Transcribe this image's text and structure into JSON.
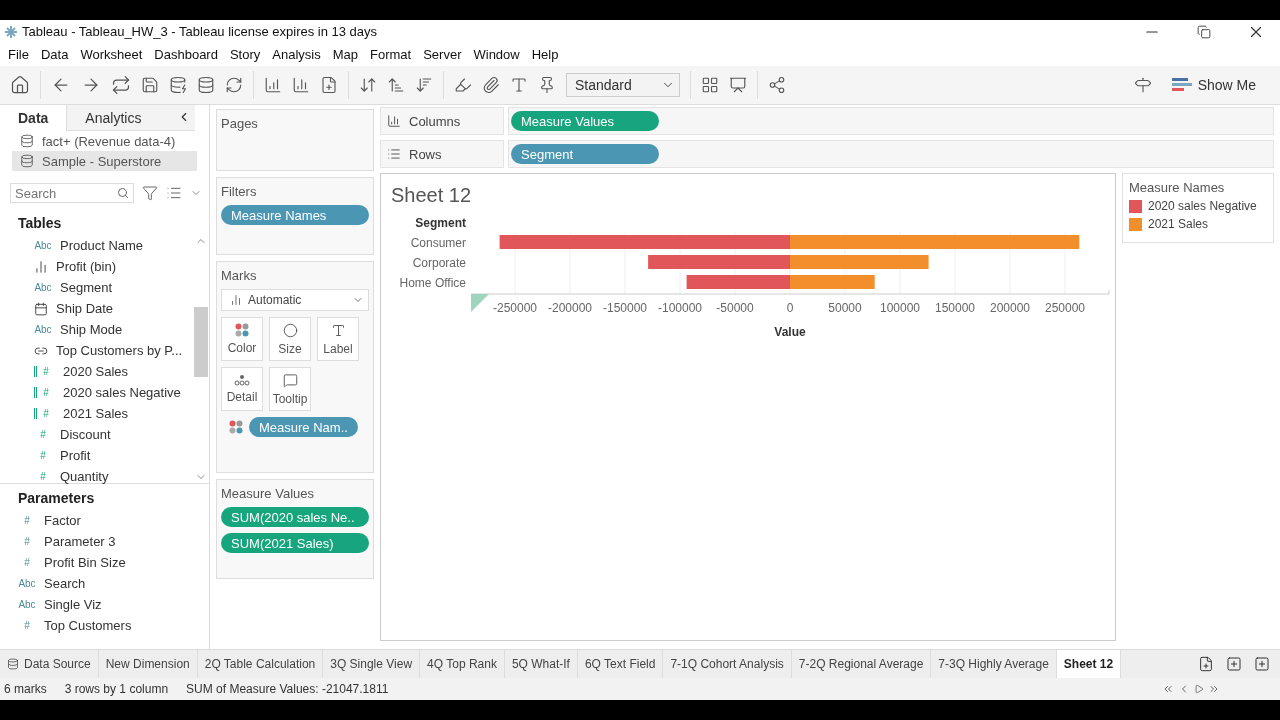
{
  "window": {
    "title": "Tableau - Tableau_HW_3 - Tableau license expires in 13 days"
  },
  "menu": [
    "File",
    "Data",
    "Worksheet",
    "Dashboard",
    "Story",
    "Analysis",
    "Map",
    "Format",
    "Server",
    "Window",
    "Help"
  ],
  "toolbar": {
    "fit": "Standard",
    "show_me": "Show Me"
  },
  "side_tabs": [
    {
      "label": "Data",
      "selected": true
    },
    {
      "label": "Analytics",
      "selected": false
    }
  ],
  "data_sources": [
    {
      "label": "fact+ (Revenue data-4)",
      "selected": false
    },
    {
      "label": "Sample - Superstore",
      "selected": true
    }
  ],
  "search": {
    "placeholder": "Search"
  },
  "tables": {
    "title": "Tables",
    "fields": [
      {
        "label": "Product Name",
        "kind": "text",
        "badge": "Abc"
      },
      {
        "label": "Profit (bin)",
        "kind": "bin"
      },
      {
        "label": "Segment",
        "kind": "text",
        "badge": "Abc"
      },
      {
        "label": "Ship Date",
        "kind": "date"
      },
      {
        "label": "Ship Mode",
        "kind": "text",
        "badge": "Abc"
      },
      {
        "label": "Top Customers by P...",
        "kind": "set"
      },
      {
        "label": "2020 Sales",
        "kind": "calc",
        "badge": "#"
      },
      {
        "label": "2020 sales Negative",
        "kind": "calc",
        "badge": "#"
      },
      {
        "label": "2021 Sales",
        "kind": "calc",
        "badge": "#"
      },
      {
        "label": "Discount",
        "kind": "number",
        "badge": "#"
      },
      {
        "label": "Profit",
        "kind": "number",
        "badge": "#"
      },
      {
        "label": "Quantity",
        "kind": "number",
        "badge": "#"
      }
    ]
  },
  "parameters": {
    "title": "Parameters",
    "fields": [
      {
        "label": "Factor",
        "badge": "#"
      },
      {
        "label": "Parameter 3",
        "badge": "#"
      },
      {
        "label": "Profit Bin Size",
        "badge": "#"
      },
      {
        "label": "Search",
        "badge": "Abc"
      },
      {
        "label": "Single Viz",
        "badge": "Abc"
      },
      {
        "label": "Top Customers",
        "badge": "#"
      }
    ]
  },
  "pages": {
    "title": "Pages"
  },
  "filters": {
    "title": "Filters",
    "pills": [
      {
        "label": "Measure Names",
        "kind": "dimension"
      }
    ]
  },
  "marks": {
    "title": "Marks",
    "type": "Automatic",
    "cards": [
      {
        "label": "Color",
        "kind": "color"
      },
      {
        "label": "Size",
        "kind": "size"
      },
      {
        "label": "Label",
        "kind": "label"
      },
      {
        "label": "Detail",
        "kind": "detail"
      },
      {
        "label": "Tooltip",
        "kind": "tooltip"
      }
    ],
    "pills": [
      {
        "label": "Measure Nam..",
        "kind": "dimension"
      }
    ]
  },
  "measure_values": {
    "title": "Measure Values",
    "pills": [
      {
        "label": "SUM(2020 sales Ne..",
        "kind": "measure"
      },
      {
        "label": "SUM(2021 Sales)",
        "kind": "measure"
      }
    ]
  },
  "shelves": [
    {
      "label": "Columns",
      "pill": {
        "label": "Measure Values",
        "kind": "measure"
      }
    },
    {
      "label": "Rows",
      "pill": {
        "label": "Segment",
        "kind": "dimension"
      }
    }
  ],
  "sheet": {
    "title": "Sheet 12",
    "chart_data": {
      "type": "bar",
      "orientation": "horizontal",
      "stacked": true,
      "xlabel": "Value",
      "ylabel": "Segment",
      "categories": [
        "Consumer",
        "Corporate",
        "Home Office"
      ],
      "series": [
        {
          "name": "2020 sales Negative",
          "color": "#e15759",
          "values": [
            -264000,
            -129000,
            -94000
          ]
        },
        {
          "name": "2021 Sales",
          "color": "#f28e2b",
          "values": [
            263000,
            126000,
            77000
          ]
        }
      ],
      "xticks": [
        -250000,
        -200000,
        -150000,
        -100000,
        -50000,
        0,
        50000,
        100000,
        150000,
        200000,
        250000
      ],
      "xlim": [
        -290000,
        290000
      ],
      "grid": true
    }
  },
  "legend": {
    "title": "Measure Names"
  },
  "sheet_tabs": [
    {
      "label": "Data Source",
      "kind": "source",
      "selected": false
    },
    {
      "label": "New Dimension",
      "selected": false
    },
    {
      "label": "2Q Table Calculation",
      "selected": false
    },
    {
      "label": "3Q Single View",
      "selected": false
    },
    {
      "label": "4Q Top Rank",
      "selected": false
    },
    {
      "label": "5Q What-If",
      "selected": false
    },
    {
      "label": "6Q Text Field",
      "selected": false
    },
    {
      "label": "7-1Q Cohort Analysis",
      "selected": false
    },
    {
      "label": "7-2Q Regional Average",
      "selected": false
    },
    {
      "label": "7-3Q Highly Average",
      "selected": false
    },
    {
      "label": "Sheet 12",
      "selected": true
    }
  ],
  "status_bar": [
    "6 marks",
    "3 rows by 1 column",
    "SUM of Measure Values: -21047.1811"
  ]
}
